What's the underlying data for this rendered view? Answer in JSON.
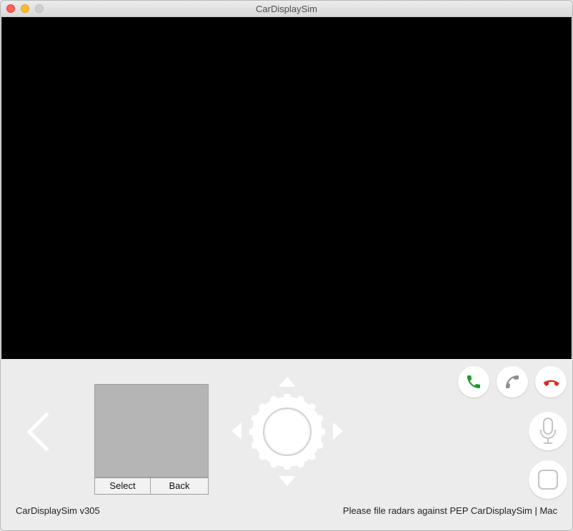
{
  "window": {
    "title": "CarDisplaySim"
  },
  "touchpad": {
    "select_label": "Select",
    "back_label": "Back"
  },
  "icons": {
    "back": "chevron-left-icon",
    "accept": "phone-icon",
    "dial": "phone-icon",
    "end": "phone-hangup-icon",
    "mic": "microphone-icon",
    "home": "home-square-icon"
  },
  "colors": {
    "accept": "#1f9a2f",
    "dial": "#8e8e8e",
    "end": "#d0301f",
    "display": "#000000"
  },
  "footer": {
    "version": "CarDisplaySim v305",
    "note": "Please file radars against PEP CarDisplaySim | Mac"
  }
}
